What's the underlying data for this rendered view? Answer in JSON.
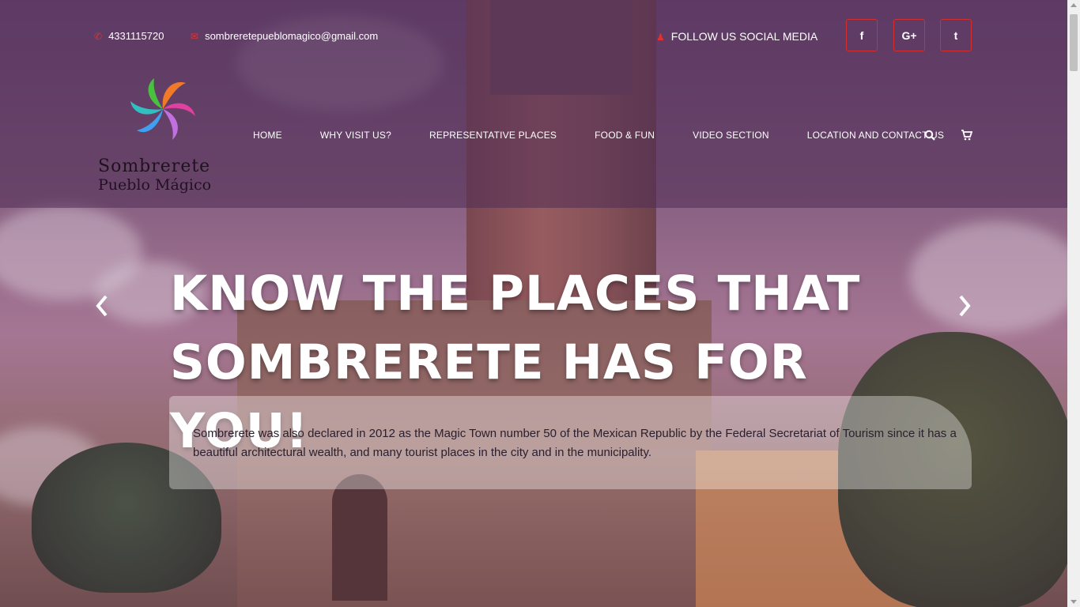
{
  "topbar": {
    "phone": "4331115720",
    "phone_icon": "phone-icon",
    "email": "sombreretepueblomagico@gmail.com",
    "email_icon": "envelope-icon",
    "follow_label": "FOLLOW US SOCIAL MEDIA",
    "follow_icon": "user-icon",
    "social": [
      {
        "label": "f",
        "icon": "facebook-icon"
      },
      {
        "label": "G+",
        "icon": "google-plus-icon"
      },
      {
        "label": "t",
        "icon": "twitter-icon"
      }
    ]
  },
  "logo": {
    "line1": "Sombrerete",
    "line2": "Pueblo Mágico"
  },
  "nav": {
    "items": [
      "HOME",
      "WHY VISIT US?",
      "REPRESENTATIVE PLACES",
      "FOOD & FUN",
      "VIDEO SECTION",
      "LOCATION AND CONTACT US"
    ],
    "search_icon": "search-icon",
    "cart_icon": "cart-icon"
  },
  "hero": {
    "title_line1": "KNOW THE PLACES THAT",
    "title_line2": "SOMBRERETE HAS FOR YOU!",
    "description": "Sombrerete was also declared in 2012 as the Magic Town number 50 of the Mexican Republic by the Federal Secretariat of Tourism since it has a beautiful architectural wealth, and many tourist places in the city and in the municipality.",
    "prev_icon": "chevron-left-icon",
    "next_icon": "chevron-right-icon"
  },
  "colors": {
    "accent_red": "#e0322e",
    "header_overlay": "#502d55"
  }
}
